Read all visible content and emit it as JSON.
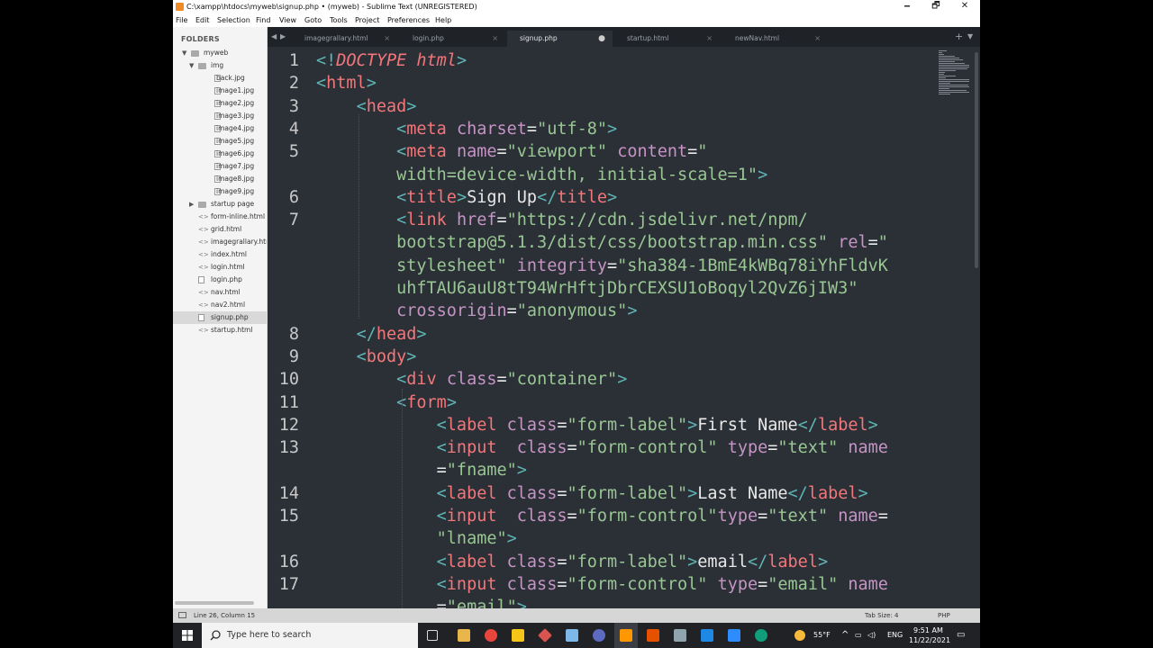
{
  "window": {
    "title": "C:\\xampp\\htdocs\\myweb\\signup.php • (myweb) - Sublime Text (UNREGISTERED)",
    "minimize": "🗕",
    "maximize": "🗗",
    "close": "✕"
  },
  "menu": [
    "File",
    "Edit",
    "Selection",
    "Find",
    "View",
    "Goto",
    "Tools",
    "Project",
    "Preferences",
    "Help"
  ],
  "sidebar": {
    "header": "FOLDERS",
    "items": [
      {
        "label": "myweb",
        "kind": "folder",
        "open": true,
        "depth": 0
      },
      {
        "label": "img",
        "kind": "folder",
        "open": true,
        "depth": 1
      },
      {
        "label": "back.jpg",
        "kind": "image",
        "depth": 2
      },
      {
        "label": "image1.jpg",
        "kind": "image",
        "depth": 2
      },
      {
        "label": "image2.jpg",
        "kind": "image",
        "depth": 2
      },
      {
        "label": "image3.jpg",
        "kind": "image",
        "depth": 2
      },
      {
        "label": "image4.jpg",
        "kind": "image",
        "depth": 2
      },
      {
        "label": "image5.jpg",
        "kind": "image",
        "depth": 2
      },
      {
        "label": "image6.jpg",
        "kind": "image",
        "depth": 2
      },
      {
        "label": "image7.jpg",
        "kind": "image",
        "depth": 2
      },
      {
        "label": "image8.jpg",
        "kind": "image",
        "depth": 2
      },
      {
        "label": "image9.jpg",
        "kind": "image",
        "depth": 2
      },
      {
        "label": "startup page",
        "kind": "folder",
        "open": false,
        "depth": 1
      },
      {
        "label": "form-inline.html",
        "kind": "code",
        "depth": 1
      },
      {
        "label": "grid.html",
        "kind": "code",
        "depth": 1
      },
      {
        "label": "imagegrallary.html",
        "kind": "code",
        "depth": 1
      },
      {
        "label": "index.html",
        "kind": "code",
        "depth": 1
      },
      {
        "label": "login.html",
        "kind": "code",
        "depth": 1
      },
      {
        "label": "login.php",
        "kind": "file",
        "depth": 1
      },
      {
        "label": "nav.html",
        "kind": "code",
        "depth": 1
      },
      {
        "label": "nav2.html",
        "kind": "code",
        "depth": 1
      },
      {
        "label": "signup.php",
        "kind": "file",
        "depth": 1,
        "selected": true
      },
      {
        "label": "startup.html",
        "kind": "code",
        "depth": 1
      }
    ]
  },
  "tabs": [
    {
      "label": "imagegrallary.html",
      "close": "×",
      "active": false
    },
    {
      "label": "login.php",
      "close": "×",
      "active": false
    },
    {
      "label": "signup.php",
      "close": "●",
      "active": true
    },
    {
      "label": "startup.html",
      "close": "×",
      "active": false
    },
    {
      "label": "newNav.html",
      "close": "×",
      "active": false
    }
  ],
  "tab_nav": {
    "left": "◀",
    "right": "▶",
    "plus": "+",
    "more": "▼"
  },
  "code": {
    "line_numbers": [
      "1",
      "2",
      "3",
      "4",
      "5",
      "",
      "6",
      "7",
      "",
      "",
      "",
      "",
      "8",
      "9",
      "10",
      "11",
      "12",
      "13",
      "",
      "14",
      "15",
      "",
      "16",
      "17"
    ],
    "lines": [
      [
        [
          "br",
          "<!"
        ],
        [
          "dt",
          "DOCTYPE html"
        ],
        [
          "br",
          ">"
        ]
      ],
      [
        [
          "br",
          "<"
        ],
        [
          "tg",
          "html"
        ],
        [
          "br",
          ">"
        ]
      ],
      [
        [
          "tx2",
          "    "
        ],
        [
          "br",
          "<"
        ],
        [
          "tg",
          "head"
        ],
        [
          "br",
          ">"
        ]
      ],
      [
        [
          "tx2",
          "        "
        ],
        [
          "br",
          "<"
        ],
        [
          "tg",
          "meta"
        ],
        [
          "tx2",
          " "
        ],
        [
          "at",
          "charset"
        ],
        [
          "tx2",
          "="
        ],
        [
          "st",
          "\"utf-8\""
        ],
        [
          "br",
          ">"
        ]
      ],
      [
        [
          "tx2",
          "        "
        ],
        [
          "br",
          "<"
        ],
        [
          "tg",
          "meta"
        ],
        [
          "tx2",
          " "
        ],
        [
          "at",
          "name"
        ],
        [
          "tx2",
          "="
        ],
        [
          "st",
          "\"viewport\""
        ],
        [
          "tx2",
          " "
        ],
        [
          "at",
          "content"
        ],
        [
          "tx2",
          "="
        ],
        [
          "st",
          "\""
        ]
      ],
      [
        [
          "tx2",
          "        "
        ],
        [
          "st",
          "width=device-width, initial-scale=1\""
        ],
        [
          "br",
          ">"
        ]
      ],
      [
        [
          "tx2",
          "        "
        ],
        [
          "br",
          "<"
        ],
        [
          "tg",
          "title"
        ],
        [
          "br",
          ">"
        ],
        [
          "tx2",
          "Sign Up"
        ],
        [
          "br",
          "</"
        ],
        [
          "tg",
          "title"
        ],
        [
          "br",
          ">"
        ]
      ],
      [
        [
          "tx2",
          "        "
        ],
        [
          "br",
          "<"
        ],
        [
          "tg",
          "link"
        ],
        [
          "tx2",
          " "
        ],
        [
          "at",
          "href"
        ],
        [
          "tx2",
          "="
        ],
        [
          "st",
          "\"https://cdn.jsdelivr.net/npm/"
        ]
      ],
      [
        [
          "tx2",
          "        "
        ],
        [
          "st",
          "bootstrap@5.1.3/dist/css/bootstrap.min.css\""
        ],
        [
          "tx2",
          " "
        ],
        [
          "at",
          "rel"
        ],
        [
          "tx2",
          "="
        ],
        [
          "st",
          "\""
        ]
      ],
      [
        [
          "tx2",
          "        "
        ],
        [
          "st",
          "stylesheet\""
        ],
        [
          "tx2",
          " "
        ],
        [
          "at",
          "integrity"
        ],
        [
          "tx2",
          "="
        ],
        [
          "st",
          "\"sha384-1BmE4kWBq78iYhFldvK"
        ]
      ],
      [
        [
          "tx2",
          "        "
        ],
        [
          "st",
          "uhfTAU6auU8tT94WrHftjDbrCEXSU1oBoqyl2QvZ6jIW3\""
        ]
      ],
      [
        [
          "tx2",
          "        "
        ],
        [
          "at",
          "crossorigin"
        ],
        [
          "tx2",
          "="
        ],
        [
          "st",
          "\"anonymous\""
        ],
        [
          "br",
          ">"
        ]
      ],
      [
        [
          "tx2",
          "    "
        ],
        [
          "br",
          "</"
        ],
        [
          "tg",
          "head"
        ],
        [
          "br",
          ">"
        ]
      ],
      [
        [
          "tx2",
          "    "
        ],
        [
          "br",
          "<"
        ],
        [
          "tg",
          "body"
        ],
        [
          "br",
          ">"
        ]
      ],
      [
        [
          "tx2",
          "        "
        ],
        [
          "br",
          "<"
        ],
        [
          "tg",
          "div"
        ],
        [
          "tx2",
          " "
        ],
        [
          "at",
          "class"
        ],
        [
          "tx2",
          "="
        ],
        [
          "st",
          "\"container\""
        ],
        [
          "br",
          ">"
        ]
      ],
      [
        [
          "tx2",
          "        "
        ],
        [
          "br",
          "<"
        ],
        [
          "tg",
          "form"
        ],
        [
          "br",
          ">"
        ]
      ],
      [
        [
          "tx2",
          "            "
        ],
        [
          "br",
          "<"
        ],
        [
          "tg",
          "label"
        ],
        [
          "tx2",
          " "
        ],
        [
          "at",
          "class"
        ],
        [
          "tx2",
          "="
        ],
        [
          "st",
          "\"form-label\""
        ],
        [
          "br",
          ">"
        ],
        [
          "tx2",
          "First Name"
        ],
        [
          "br",
          "</"
        ],
        [
          "tg",
          "label"
        ],
        [
          "br",
          ">"
        ]
      ],
      [
        [
          "tx2",
          "            "
        ],
        [
          "br",
          "<"
        ],
        [
          "tg",
          "input"
        ],
        [
          "tx2",
          "  "
        ],
        [
          "at",
          "class"
        ],
        [
          "tx2",
          "="
        ],
        [
          "st",
          "\"form-control\""
        ],
        [
          "tx2",
          " "
        ],
        [
          "at",
          "type"
        ],
        [
          "tx2",
          "="
        ],
        [
          "st",
          "\"text\""
        ],
        [
          "tx2",
          " "
        ],
        [
          "at",
          "name"
        ]
      ],
      [
        [
          "tx2",
          "            "
        ],
        [
          "tx2",
          "="
        ],
        [
          "st",
          "\"fname\""
        ],
        [
          "br",
          ">"
        ]
      ],
      [
        [
          "tx2",
          "            "
        ],
        [
          "br",
          "<"
        ],
        [
          "tg",
          "label"
        ],
        [
          "tx2",
          " "
        ],
        [
          "at",
          "class"
        ],
        [
          "tx2",
          "="
        ],
        [
          "st",
          "\"form-label\""
        ],
        [
          "br",
          ">"
        ],
        [
          "tx2",
          "Last Name"
        ],
        [
          "br",
          "</"
        ],
        [
          "tg",
          "label"
        ],
        [
          "br",
          ">"
        ]
      ],
      [
        [
          "tx2",
          "            "
        ],
        [
          "br",
          "<"
        ],
        [
          "tg",
          "input"
        ],
        [
          "tx2",
          "  "
        ],
        [
          "at",
          "class"
        ],
        [
          "tx2",
          "="
        ],
        [
          "st",
          "\"form-control\""
        ],
        [
          "at",
          "type"
        ],
        [
          "tx2",
          "="
        ],
        [
          "st",
          "\"text\""
        ],
        [
          "tx2",
          " "
        ],
        [
          "at",
          "name"
        ],
        [
          "tx2",
          "="
        ]
      ],
      [
        [
          "tx2",
          "            "
        ],
        [
          "st",
          "\"lname\""
        ],
        [
          "br",
          ">"
        ]
      ],
      [
        [
          "tx2",
          "            "
        ],
        [
          "br",
          "<"
        ],
        [
          "tg",
          "label"
        ],
        [
          "tx2",
          " "
        ],
        [
          "at",
          "class"
        ],
        [
          "tx2",
          "="
        ],
        [
          "st",
          "\"form-label\""
        ],
        [
          "br",
          ">"
        ],
        [
          "tx2",
          "email"
        ],
        [
          "br",
          "</"
        ],
        [
          "tg",
          "label"
        ],
        [
          "br",
          ">"
        ]
      ],
      [
        [
          "tx2",
          "            "
        ],
        [
          "br",
          "<"
        ],
        [
          "tg",
          "input"
        ],
        [
          "tx2",
          " "
        ],
        [
          "at",
          "class"
        ],
        [
          "tx2",
          "="
        ],
        [
          "st",
          "\"form-control\""
        ],
        [
          "tx2",
          " "
        ],
        [
          "at",
          "type"
        ],
        [
          "tx2",
          "="
        ],
        [
          "st",
          "\"email\""
        ],
        [
          "tx2",
          " "
        ],
        [
          "at",
          "name"
        ]
      ],
      [
        [
          "tx2",
          "            "
        ],
        [
          "tx2",
          "="
        ],
        [
          "st",
          "\"email\""
        ],
        [
          "br",
          ">"
        ]
      ]
    ]
  },
  "status": {
    "position": "Line 26, Column 15",
    "tab_size": "Tab Size: 4",
    "syntax": "PHP"
  },
  "taskbar": {
    "search_placeholder": "Type here to search",
    "weather": "55°F",
    "lang": "ENG",
    "time": "9:51 AM",
    "date": "11/22/2021"
  },
  "colors": {
    "editor_bg": "#2b2f36",
    "tag": "#f2777a",
    "attr": "#c594c5",
    "string": "#99c794",
    "bracket": "#5fb4b4"
  }
}
